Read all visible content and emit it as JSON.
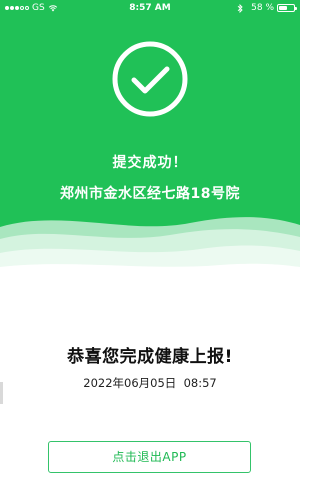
{
  "status_bar": {
    "carrier": "GS",
    "time": "8:57 AM",
    "battery_percent": "58 %",
    "battery_level": 0.58,
    "signal_filled": 3,
    "signal_total": 5,
    "icons": [
      "wifi-icon",
      "bluetooth-icon",
      "battery-icon"
    ]
  },
  "result": {
    "icon": "checkmark-icon",
    "title": "提交成功！",
    "address": "郑州市金水区经七路18号院"
  },
  "summary": {
    "message": "恭喜您完成健康上报!",
    "datetime": "2022年06月05日  08:57"
  },
  "actions": {
    "exit_label": "点击退出APP"
  },
  "colors": {
    "accent": "#20c157",
    "button_border": "#34c36a",
    "button_text": "#1fb954",
    "text_dark": "#111111"
  }
}
